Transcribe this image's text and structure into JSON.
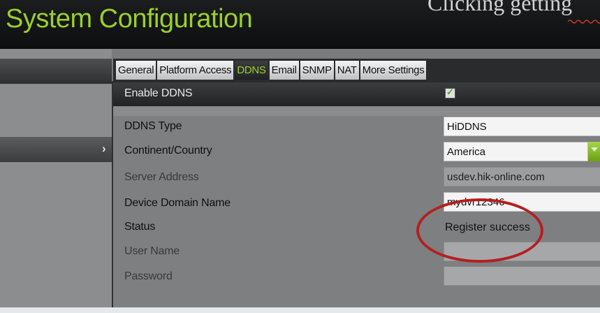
{
  "window": {
    "title": "System Configuration"
  },
  "overlay": {
    "text": "Clicking  getting"
  },
  "tabs": [
    {
      "label": "General",
      "active": false
    },
    {
      "label": "Platform Access",
      "active": false
    },
    {
      "label": "DDNS",
      "active": true
    },
    {
      "label": "Email",
      "active": false
    },
    {
      "label": "SNMP",
      "active": false
    },
    {
      "label": "NAT",
      "active": false
    },
    {
      "label": "More Settings",
      "active": false
    }
  ],
  "form": {
    "enable_ddns": {
      "label": "Enable DDNS",
      "checked": true
    },
    "ddns_type": {
      "label": "DDNS Type",
      "value": "HiDDNS"
    },
    "continent": {
      "label": "Continent/Country",
      "value": "America"
    },
    "server_address": {
      "label": "Server Address",
      "value": "usdev.hik-online.com"
    },
    "device_domain": {
      "label": "Device Domain Name",
      "value": "mydvr12346"
    },
    "status": {
      "label": "Status",
      "value": "Register success"
    },
    "user_name": {
      "label": "User Name",
      "value": ""
    },
    "password": {
      "label": "Password",
      "value": ""
    }
  },
  "colors": {
    "accent": "#9bcf2b",
    "annotation": "#b51f1f"
  },
  "icons": {
    "chevron": "chevron-right-icon",
    "checkbox": "checkmark-icon",
    "dropdown": "dropdown-arrow-icon"
  }
}
